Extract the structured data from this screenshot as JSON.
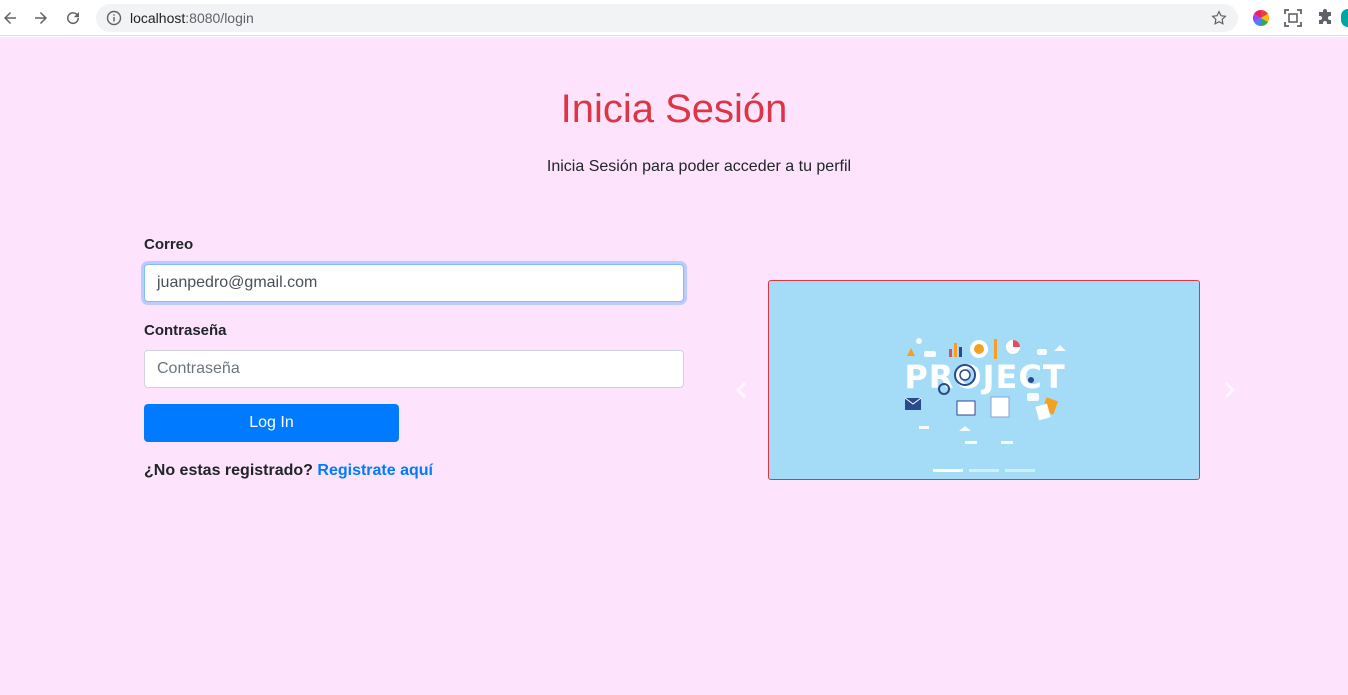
{
  "browser": {
    "url_host": "localhost",
    "url_rest": ":8080/login"
  },
  "page": {
    "title": "Inicia Sesión",
    "subtitle": "Inicia Sesión para poder acceder a tu perfil"
  },
  "form": {
    "email_label": "Correo",
    "email_value": "juanpedro@gmail.com",
    "password_label": "Contraseña",
    "password_placeholder": "Contraseña",
    "submit_label": "Log In",
    "register_prompt": "¿No estas registrado?",
    "register_link": "Registrate aquí"
  },
  "carousel": {
    "image_word": "PROJECT",
    "slides": 3,
    "active_slide": 0,
    "prev_icon": "chevron-left-icon",
    "next_icon": "chevron-right-icon"
  },
  "colors": {
    "page_bg": "#fde4fc",
    "title": "#dc3545",
    "primary": "#007bff",
    "carousel_bg": "#a4dbf6"
  }
}
